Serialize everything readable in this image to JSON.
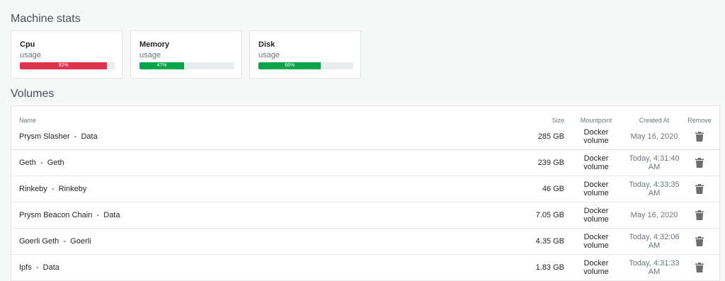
{
  "machine_stats": {
    "title": "Machine stats",
    "cards": [
      {
        "name": "Cpu",
        "sub": "usage",
        "percent": 92,
        "label": "92%",
        "color": "#e0324b"
      },
      {
        "name": "Memory",
        "sub": "usage",
        "percent": 47,
        "label": "47%",
        "color": "#07a449"
      },
      {
        "name": "Disk",
        "sub": "usage",
        "percent": 66,
        "label": "66%",
        "color": "#07a449"
      }
    ]
  },
  "volumes": {
    "title": "Volumes",
    "headers": {
      "name": "Name",
      "size": "Size",
      "mountpoint": "Mountpoint",
      "created": "Created At",
      "remove": "Remove"
    },
    "rows": [
      {
        "dnp": "Prysm Slasher",
        "sep": "-",
        "vol": "Data",
        "size": "285 GB",
        "mount": "Docker volume",
        "created": "May 16, 2020"
      },
      {
        "dnp": "Geth",
        "sep": "-",
        "vol": "Geth",
        "size": "239 GB",
        "mount": "Docker volume",
        "created": "Today, 4:31:40 AM"
      },
      {
        "dnp": "Rinkeby",
        "sep": "-",
        "vol": "Rinkeby",
        "size": "46 GB",
        "mount": "Docker volume",
        "created": "Today, 4:33:35 AM"
      },
      {
        "dnp": "Prysm Beacon Chain",
        "sep": "-",
        "vol": "Data",
        "size": "7.05 GB",
        "mount": "Docker volume",
        "created": "May 16, 2020"
      },
      {
        "dnp": "Goerli Geth",
        "sep": "-",
        "vol": "Goerli",
        "size": "4.35 GB",
        "mount": "Docker volume",
        "created": "Today, 4:32:06 AM"
      },
      {
        "dnp": "Ipfs",
        "sep": "-",
        "vol": "Data",
        "size": "1.83 GB",
        "mount": "Docker volume",
        "created": "Today, 4:31:33 AM"
      }
    ],
    "icon": "trash-icon"
  }
}
